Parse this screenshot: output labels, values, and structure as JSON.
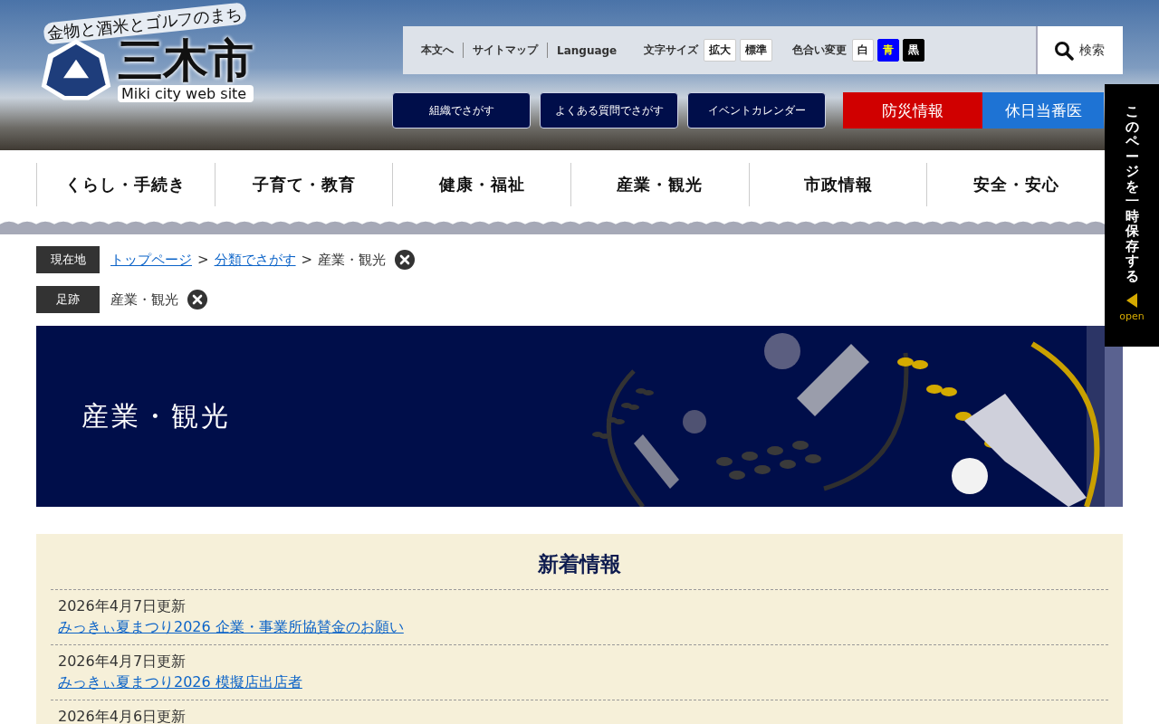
{
  "logo": {
    "tagline": "金物と酒米とゴルフのまち",
    "name": "三木市",
    "subtitle": "Miki city web site"
  },
  "utility_links": [
    "本文へ",
    "サイトマップ",
    "Language"
  ],
  "font_size": {
    "label": "文字サイズ",
    "buttons": [
      "拡大",
      "標準"
    ]
  },
  "color_change": {
    "label": "色合い変更",
    "buttons": [
      {
        "label": "白",
        "kind": "white"
      },
      {
        "label": "青",
        "kind": "blue"
      },
      {
        "label": "黒",
        "kind": "black"
      }
    ]
  },
  "search": {
    "label": "検索"
  },
  "search_buttons": [
    "組織でさがす",
    "よくある質問でさがす",
    "イベントカレンダー"
  ],
  "emergency_buttons": [
    {
      "label": "防災情報",
      "kind": "disaster"
    },
    {
      "label": "休日当番医",
      "kind": "doctor"
    }
  ],
  "side_tab": {
    "label": "このページを一時保存する",
    "action": "open"
  },
  "nav": [
    "くらし・手続き",
    "子育て・教育",
    "健康・福祉",
    "産業・観光",
    "市政情報",
    "安全・安心"
  ],
  "breadcrumb": {
    "label": "現在地",
    "links": [
      "トップページ",
      "分類でさがす"
    ],
    "separator": ">",
    "current": "産業・観光"
  },
  "history": {
    "label": "足跡",
    "items": [
      "産業・観光"
    ]
  },
  "banner": {
    "title": "産業・観光"
  },
  "news": {
    "title": "新着情報",
    "items": [
      {
        "date": "2026年4月7日更新",
        "title": "みっきぃ夏まつり2026 企業・事業所協賛金のお願い"
      },
      {
        "date": "2026年4月7日更新",
        "title": "みっきぃ夏まつり2026 模擬店出店者"
      },
      {
        "date": "2026年4月6日更新"
      }
    ]
  }
}
